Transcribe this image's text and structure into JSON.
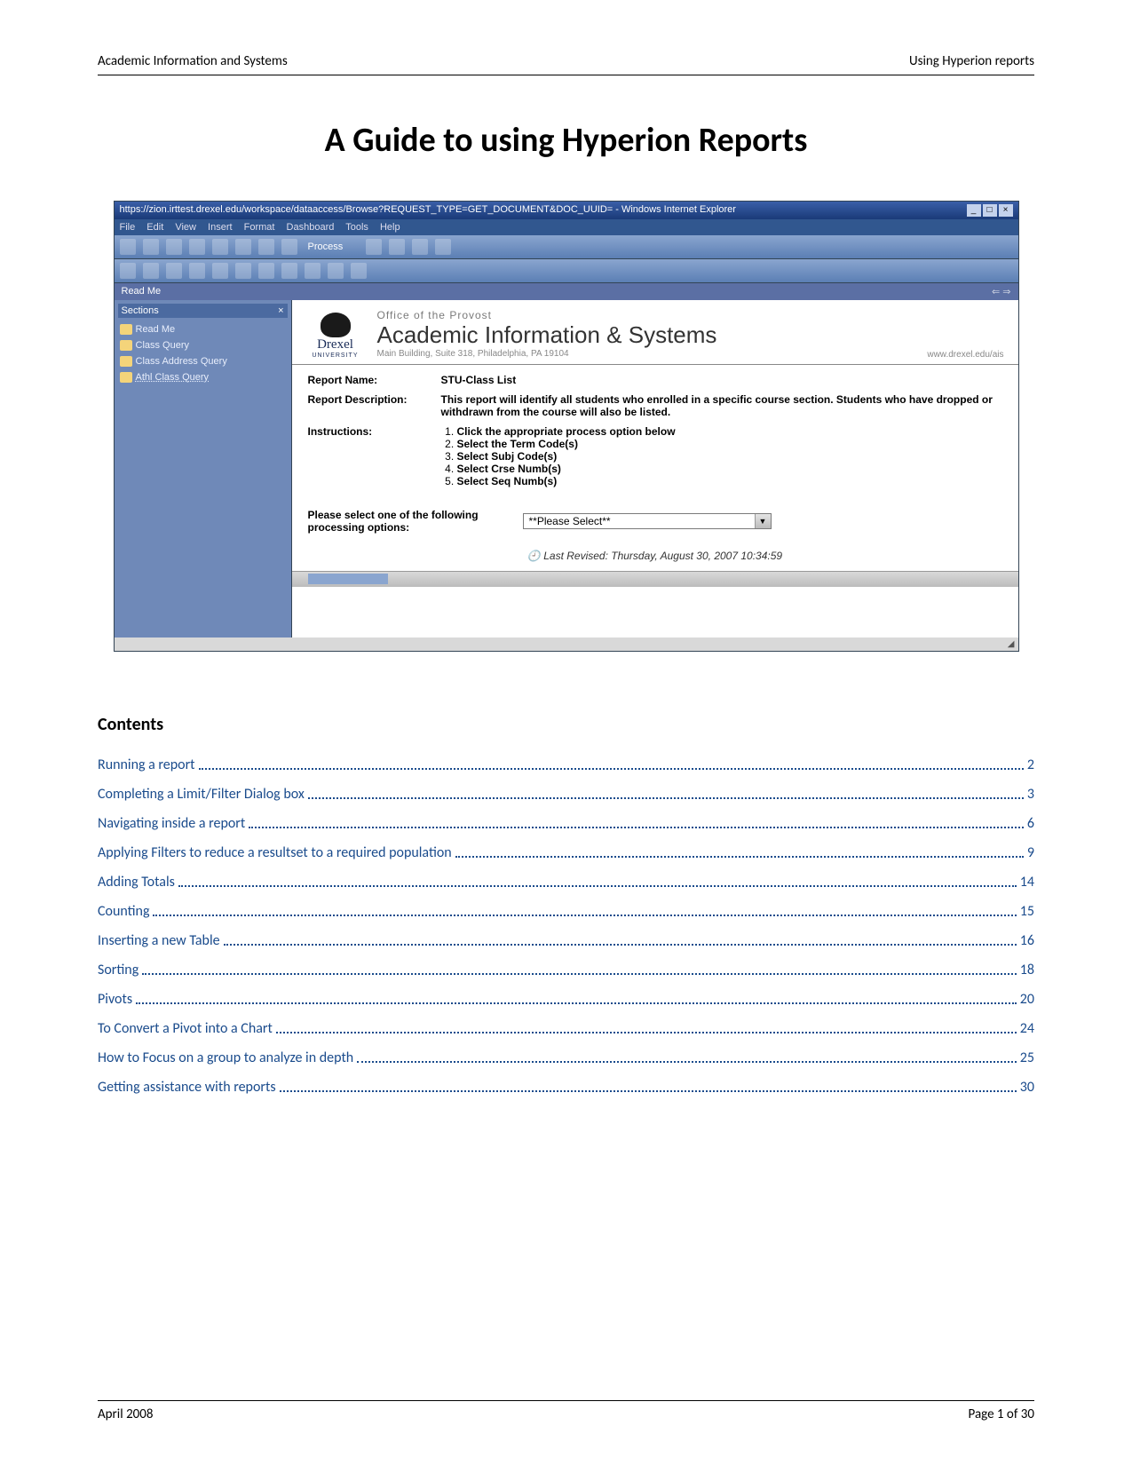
{
  "header": {
    "left": "Academic Information and Systems",
    "right": "Using Hyperion reports"
  },
  "title": "A Guide to using Hyperion Reports",
  "screenshot": {
    "url": "https://zion.irttest.drexel.edu/workspace/dataaccess/Browse?REQUEST_TYPE=GET_DOCUMENT&DOC_UUID= - Windows Internet Explorer",
    "menu": [
      "File",
      "Edit",
      "View",
      "Insert",
      "Format",
      "Dashboard",
      "Tools",
      "Help"
    ],
    "process_label": "Process",
    "breadcrumb": "Read Me",
    "sections_hdr": "Sections",
    "tree": [
      {
        "label": "Read Me"
      },
      {
        "label": "Class Query"
      },
      {
        "label": "Class Address Query"
      },
      {
        "label": "Athl Class Query"
      }
    ],
    "logo": {
      "name": "Drexel",
      "sub": "UNIVERSITY"
    },
    "office": "Office of the Provost",
    "ais_title": "Academic Information & Systems",
    "address": "Main Building, Suite 318, Philadelphia, PA 19104",
    "site": "www.drexel.edu/ais",
    "report_name_label": "Report Name:",
    "report_name": "STU-Class List",
    "report_desc_label": "Report Description:",
    "report_desc": "This report will identify all students who enrolled in a specific course section. Students who have dropped or withdrawn from the course will also be listed.",
    "instructions_label": "Instructions:",
    "instructions": [
      "Click the appropriate process option below",
      "Select the Term Code(s)",
      "Select Subj Code(s)",
      "Select Crse Numb(s)",
      "Select Seq Numb(s)"
    ],
    "select_label": "Please select one of the following processing options:",
    "select_value": "**Please Select**",
    "last_revised": "Last Revised: Thursday, August 30, 2007 10:34:59"
  },
  "contents_heading": "Contents",
  "toc": [
    {
      "label": "Running a report",
      "page": "2"
    },
    {
      "label": "Completing a Limit/Filter Dialog box",
      "page": "3"
    },
    {
      "label": "Navigating inside a report",
      "page": "6"
    },
    {
      "label": "Applying Filters to reduce a resultset to a required population",
      "page": "9"
    },
    {
      "label": "Adding Totals",
      "page": "14"
    },
    {
      "label": "Counting",
      "page": "15"
    },
    {
      "label": "Inserting a new Table",
      "page": "16"
    },
    {
      "label": "Sorting",
      "page": "18"
    },
    {
      "label": "Pivots",
      "page": "20"
    },
    {
      "label": "To Convert a Pivot into a Chart",
      "page": "24"
    },
    {
      "label": "How to Focus on a group to analyze in depth",
      "page": "25"
    },
    {
      "label": "Getting assistance with reports",
      "page": "30"
    }
  ],
  "footer": {
    "left": "April 2008",
    "right": "Page 1 of 30"
  }
}
